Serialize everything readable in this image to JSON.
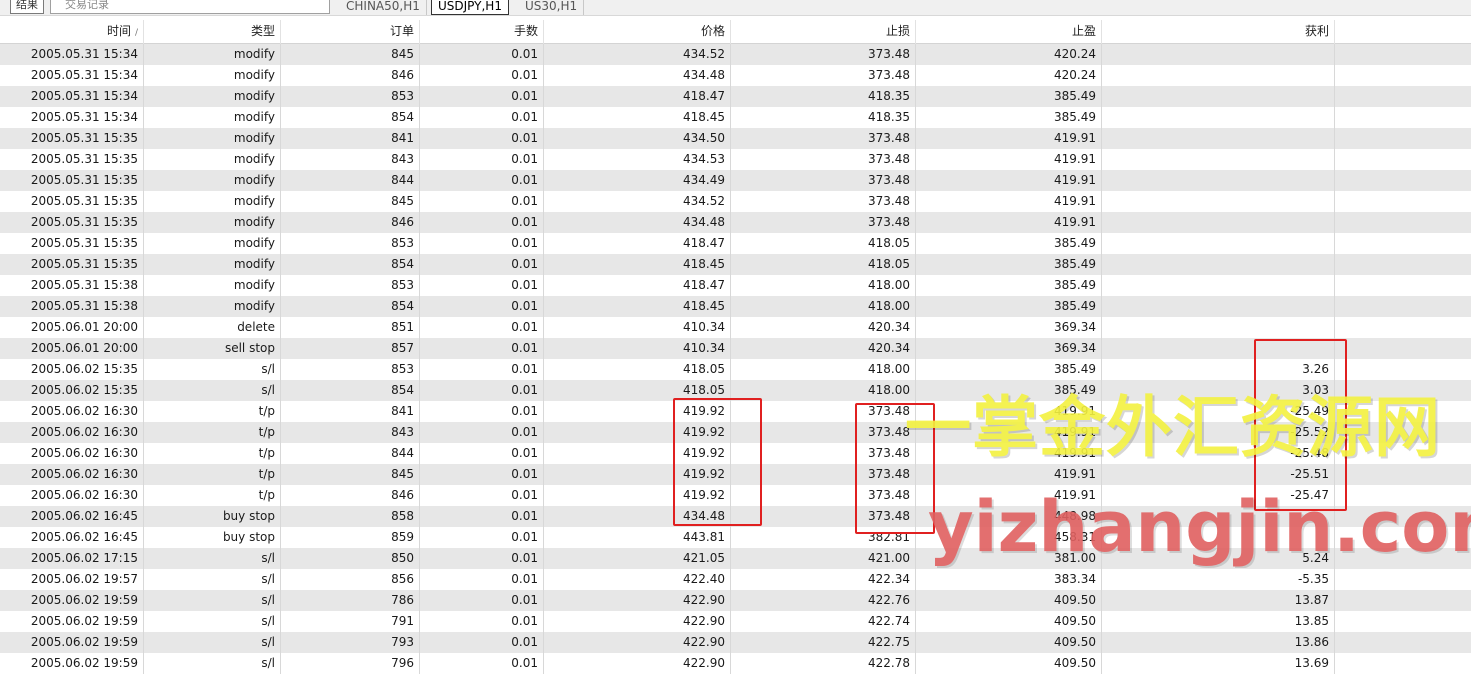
{
  "toolbar": {
    "left_button": "结果",
    "field_text": "交易记录"
  },
  "chart_tabs": [
    "CHINA50,H1",
    "USDJPY,H1",
    "US30,H1"
  ],
  "table": {
    "columns": [
      "时间",
      "类型",
      "订单",
      "手数",
      "价格",
      "止损",
      "止盈",
      "获利"
    ],
    "sort_indicator": "/",
    "rows": [
      [
        "2005.05.31 15:34",
        "modify",
        "845",
        "0.01",
        "434.52",
        "373.48",
        "420.24",
        ""
      ],
      [
        "2005.05.31 15:34",
        "modify",
        "846",
        "0.01",
        "434.48",
        "373.48",
        "420.24",
        ""
      ],
      [
        "2005.05.31 15:34",
        "modify",
        "853",
        "0.01",
        "418.47",
        "418.35",
        "385.49",
        ""
      ],
      [
        "2005.05.31 15:34",
        "modify",
        "854",
        "0.01",
        "418.45",
        "418.35",
        "385.49",
        ""
      ],
      [
        "2005.05.31 15:35",
        "modify",
        "841",
        "0.01",
        "434.50",
        "373.48",
        "419.91",
        ""
      ],
      [
        "2005.05.31 15:35",
        "modify",
        "843",
        "0.01",
        "434.53",
        "373.48",
        "419.91",
        ""
      ],
      [
        "2005.05.31 15:35",
        "modify",
        "844",
        "0.01",
        "434.49",
        "373.48",
        "419.91",
        ""
      ],
      [
        "2005.05.31 15:35",
        "modify",
        "845",
        "0.01",
        "434.52",
        "373.48",
        "419.91",
        ""
      ],
      [
        "2005.05.31 15:35",
        "modify",
        "846",
        "0.01",
        "434.48",
        "373.48",
        "419.91",
        ""
      ],
      [
        "2005.05.31 15:35",
        "modify",
        "853",
        "0.01",
        "418.47",
        "418.05",
        "385.49",
        ""
      ],
      [
        "2005.05.31 15:35",
        "modify",
        "854",
        "0.01",
        "418.45",
        "418.05",
        "385.49",
        ""
      ],
      [
        "2005.05.31 15:38",
        "modify",
        "853",
        "0.01",
        "418.47",
        "418.00",
        "385.49",
        ""
      ],
      [
        "2005.05.31 15:38",
        "modify",
        "854",
        "0.01",
        "418.45",
        "418.00",
        "385.49",
        ""
      ],
      [
        "2005.06.01 20:00",
        "delete",
        "851",
        "0.01",
        "410.34",
        "420.34",
        "369.34",
        ""
      ],
      [
        "2005.06.01 20:00",
        "sell stop",
        "857",
        "0.01",
        "410.34",
        "420.34",
        "369.34",
        ""
      ],
      [
        "2005.06.02 15:35",
        "s/l",
        "853",
        "0.01",
        "418.05",
        "418.00",
        "385.49",
        "3.26"
      ],
      [
        "2005.06.02 15:35",
        "s/l",
        "854",
        "0.01",
        "418.05",
        "418.00",
        "385.49",
        "3.03"
      ],
      [
        "2005.06.02 16:30",
        "t/p",
        "841",
        "0.01",
        "419.92",
        "373.48",
        "419.91",
        "-25.49"
      ],
      [
        "2005.06.02 16:30",
        "t/p",
        "843",
        "0.01",
        "419.92",
        "373.48",
        "419.91",
        "-25.52"
      ],
      [
        "2005.06.02 16:30",
        "t/p",
        "844",
        "0.01",
        "419.92",
        "373.48",
        "419.91",
        "-25.48"
      ],
      [
        "2005.06.02 16:30",
        "t/p",
        "845",
        "0.01",
        "419.92",
        "373.48",
        "419.91",
        "-25.51"
      ],
      [
        "2005.06.02 16:30",
        "t/p",
        "846",
        "0.01",
        "419.92",
        "373.48",
        "419.91",
        "-25.47"
      ],
      [
        "2005.06.02 16:45",
        "buy stop",
        "858",
        "0.01",
        "434.48",
        "373.48",
        "448.98",
        ""
      ],
      [
        "2005.06.02 16:45",
        "buy stop",
        "859",
        "0.01",
        "443.81",
        "382.81",
        "458.31",
        ""
      ],
      [
        "2005.06.02 17:15",
        "s/l",
        "850",
        "0.01",
        "421.05",
        "421.00",
        "381.00",
        "5.24"
      ],
      [
        "2005.06.02 19:57",
        "s/l",
        "856",
        "0.01",
        "422.40",
        "422.34",
        "383.34",
        "-5.35"
      ],
      [
        "2005.06.02 19:59",
        "s/l",
        "786",
        "0.01",
        "422.90",
        "422.76",
        "409.50",
        "13.87"
      ],
      [
        "2005.06.02 19:59",
        "s/l",
        "791",
        "0.01",
        "422.90",
        "422.74",
        "409.50",
        "13.85"
      ],
      [
        "2005.06.02 19:59",
        "s/l",
        "793",
        "0.01",
        "422.90",
        "422.75",
        "409.50",
        "13.86"
      ],
      [
        "2005.06.02 19:59",
        "s/l",
        "796",
        "0.01",
        "422.90",
        "422.78",
        "409.50",
        "13.69"
      ]
    ]
  },
  "highlight_color": "#e02020",
  "watermark": {
    "cn_text": "一掌金外汇资源网",
    "url_text": "yizhangjin.com",
    "cn_color": "#f3f140",
    "url_color": "#e06060"
  }
}
